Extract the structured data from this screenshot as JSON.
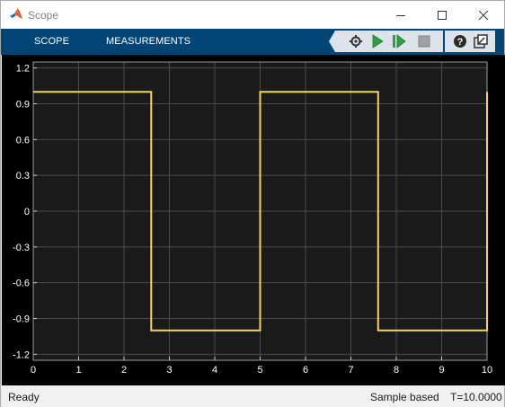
{
  "window": {
    "title": "Scope"
  },
  "toolstrip": {
    "tabs": [
      {
        "label": "SCOPE"
      },
      {
        "label": "MEASUREMENTS"
      }
    ],
    "buttons": [
      "settings-icon",
      "run-icon",
      "step-forward-icon",
      "stop-icon",
      "help-icon",
      "undock-icon"
    ]
  },
  "status": {
    "state": "Ready",
    "mode": "Sample based",
    "time": "T=10.0000"
  },
  "colors": {
    "signal": "#f4d35e",
    "plot_background": "#1a1a1a",
    "grid": "#4a4a4a",
    "toolstrip": "#004575"
  },
  "chart_data": {
    "type": "line",
    "title": "",
    "xlabel": "",
    "ylabel": "",
    "xlim": [
      0,
      10
    ],
    "ylim": [
      -1.25,
      1.25
    ],
    "grid": true,
    "x_ticks": [
      "0",
      "1",
      "2",
      "3",
      "4",
      "5",
      "6",
      "7",
      "8",
      "9",
      "10"
    ],
    "y_ticks": [
      "1.2",
      "0.9",
      "0.6",
      "0.3",
      "0",
      "-0.3",
      "-0.6",
      "-0.9",
      "-1.2"
    ],
    "series": [
      {
        "x": [
          0,
          2.6,
          2.6,
          5.0,
          5.0,
          7.6,
          7.6,
          10.0,
          10.0
        ],
        "y": [
          1,
          1,
          -1,
          -1,
          1,
          1,
          -1,
          -1,
          1
        ]
      }
    ]
  }
}
